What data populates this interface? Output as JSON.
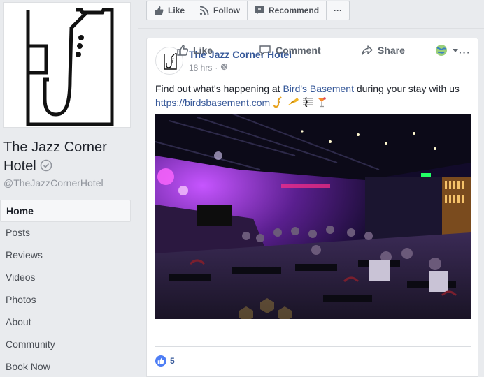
{
  "page": {
    "name": "The Jazz Corner Hotel",
    "handle": "@TheJazzCornerHotel",
    "accent_color": "#365899"
  },
  "sidebar": {
    "items": [
      {
        "label": "Home",
        "active": true
      },
      {
        "label": "Posts"
      },
      {
        "label": "Reviews"
      },
      {
        "label": "Videos"
      },
      {
        "label": "Photos"
      },
      {
        "label": "About"
      },
      {
        "label": "Community"
      },
      {
        "label": "Book Now"
      }
    ]
  },
  "actionbar": {
    "like": "Like",
    "follow": "Follow",
    "recommend": "Recommend",
    "more": "···"
  },
  "post": {
    "author": "The Jazz Corner Hotel",
    "time": "18 hrs",
    "privacy_icon": "globe-icon",
    "text_before": "Find out what's happening at ",
    "link_name": "Bird's Basement",
    "text_middle": " during your stay with us ",
    "url": "https://birdsbasement.com",
    "photo_alt": "Bird's Basement jazz club interior with stage and audience",
    "more": "···",
    "actions": {
      "like": "Like",
      "comment": "Comment",
      "share": "Share"
    },
    "reaction_count": "5"
  }
}
